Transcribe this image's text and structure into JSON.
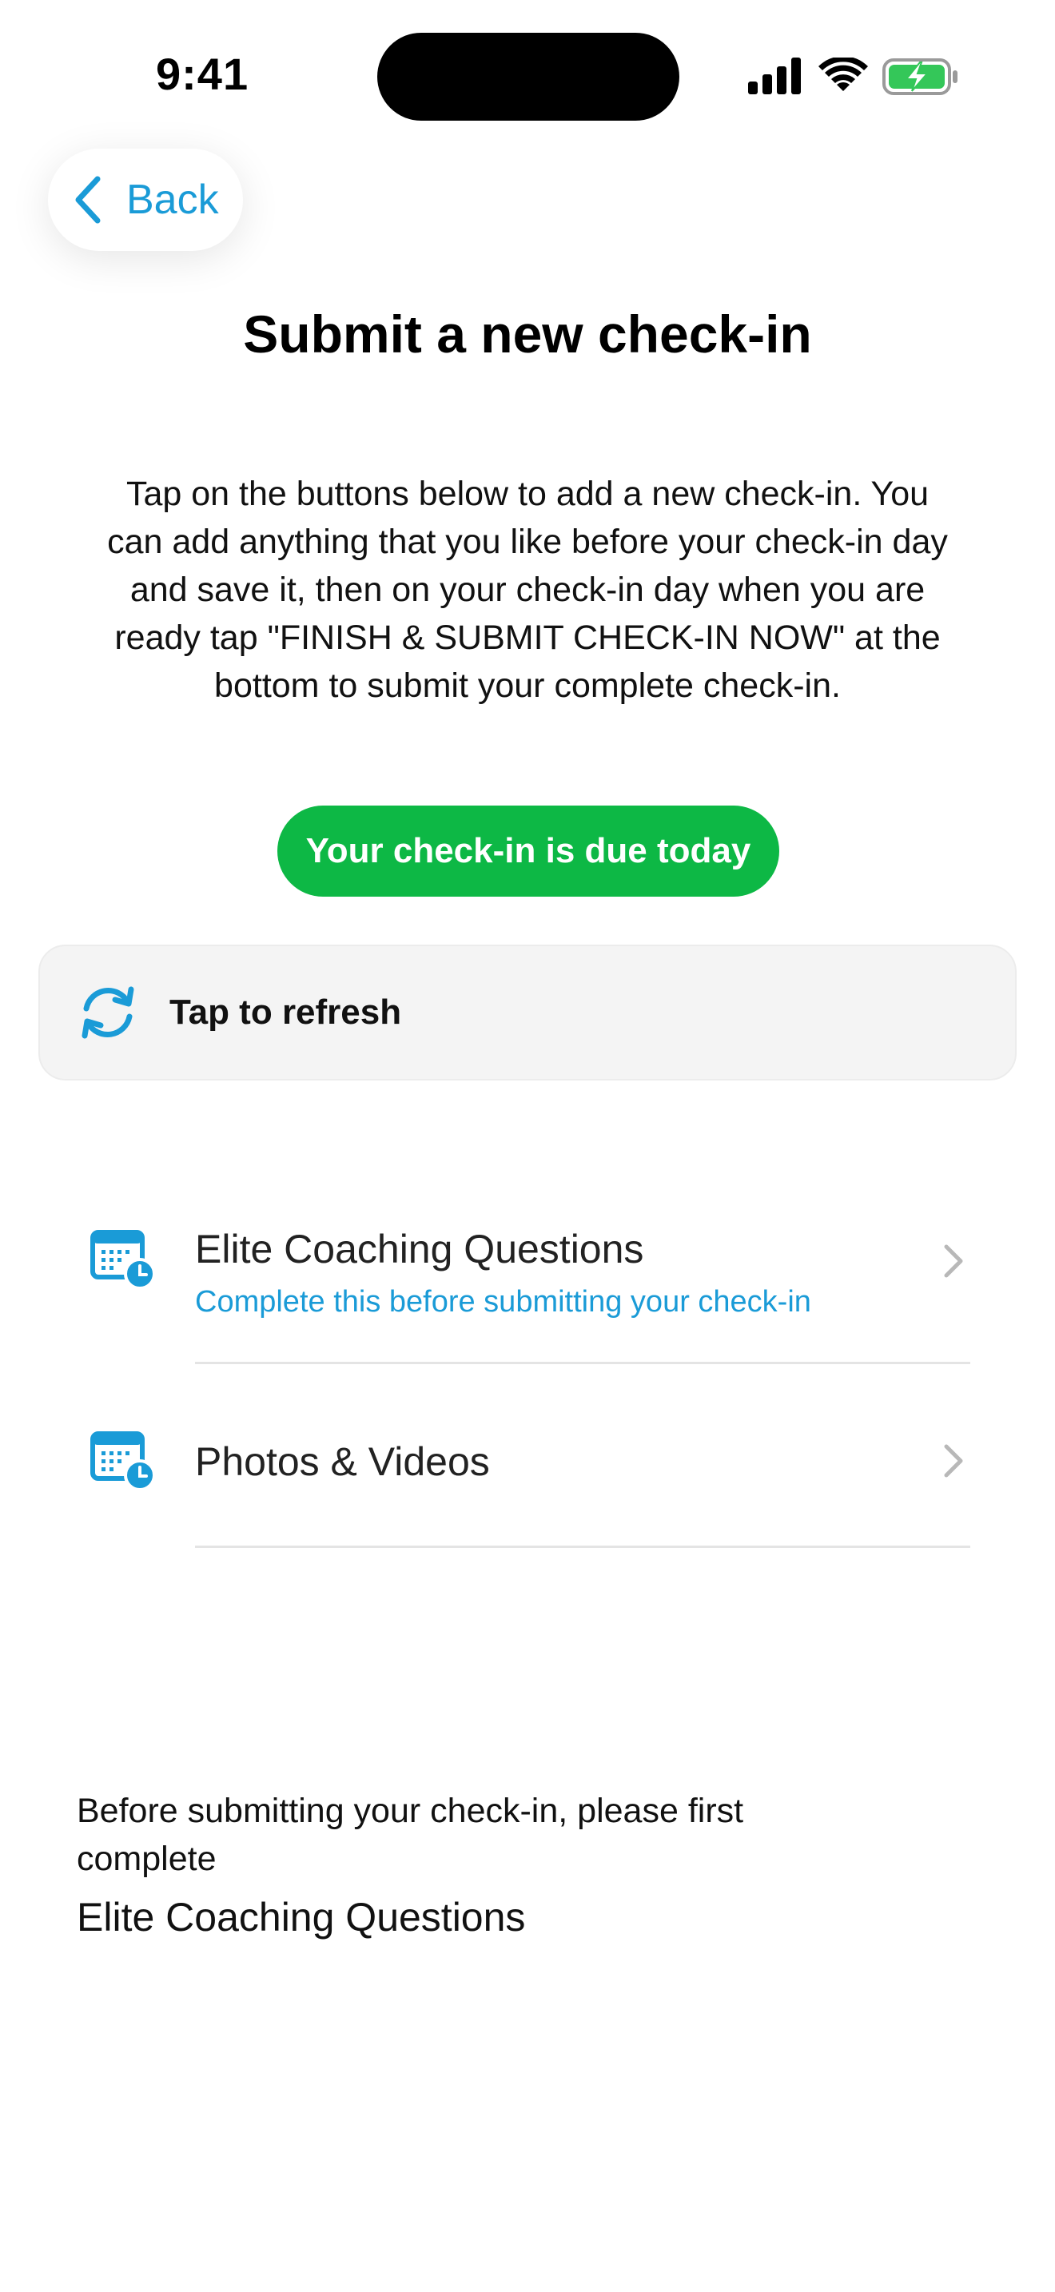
{
  "status_bar": {
    "time": "9:41",
    "icons": [
      "cellular-signal-icon",
      "wifi-icon",
      "battery-charging-icon"
    ],
    "battery_color": "#34C759"
  },
  "nav": {
    "back_label": "Back",
    "back_icon": "chevron-left-icon",
    "accent_color": "#1A9BD7"
  },
  "page": {
    "title": "Submit a new check-in",
    "instructions": "Tap on the buttons below to add a new check-in. You can add anything that you like before your check-in day and save it, then on your check-in day when you are ready tap \"FINISH & SUBMIT CHECK-IN NOW\" at the bottom to submit your complete check-in."
  },
  "due_badge": {
    "label": "Your check-in is due today",
    "color": "#0DB845"
  },
  "refresh": {
    "label": "Tap to refresh",
    "icon": "refresh-icon"
  },
  "items": [
    {
      "title": "Elite Coaching Questions",
      "subtitle": "Complete this before submitting your check-in",
      "icon": "calendar-clock-icon"
    },
    {
      "title": "Photos & Videos",
      "icon": "calendar-clock-icon"
    }
  ],
  "footer": {
    "note": "Before submitting your check-in, please first complete",
    "pending_item": "Elite Coaching Questions"
  }
}
